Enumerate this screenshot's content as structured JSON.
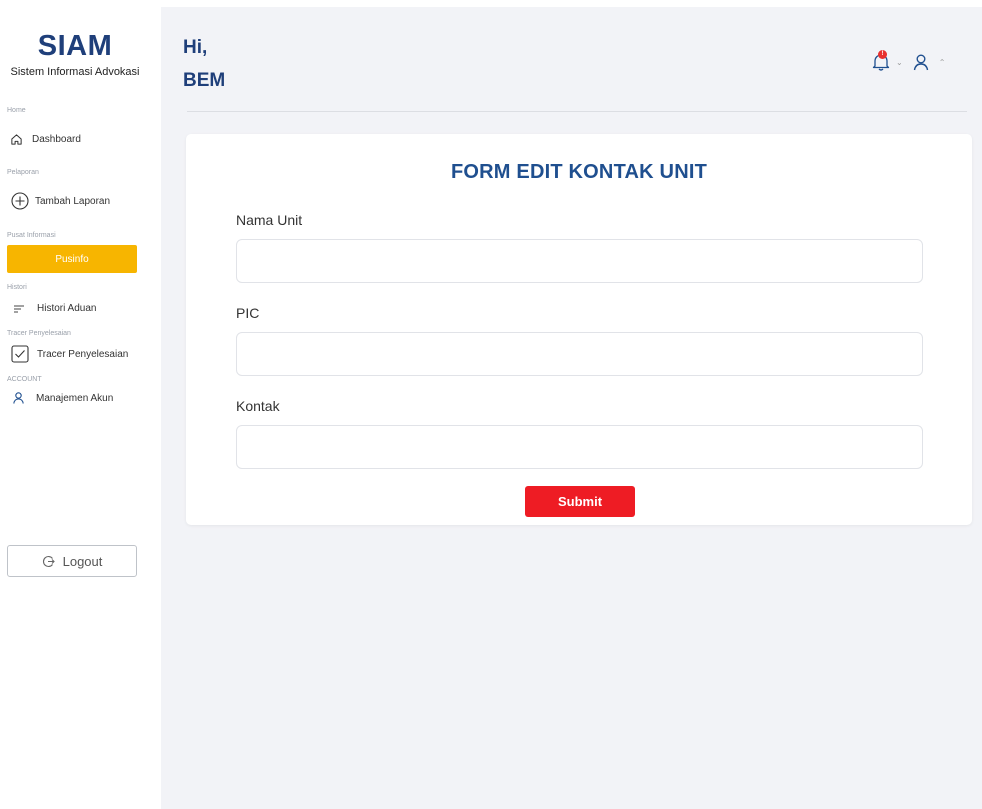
{
  "brand": {
    "title": "SIAM",
    "subtitle": "Sistem Informasi Advokasi"
  },
  "sidebar": {
    "sections": [
      {
        "label": "Home",
        "item": "Dashboard",
        "icon": "home-icon"
      },
      {
        "label": "Pelaporan",
        "item": "Tambah Laporan",
        "icon": "plus-circle-icon"
      },
      {
        "label": "Pusat Informasi",
        "item": "Pusinfo",
        "icon": ""
      },
      {
        "label": "Histori",
        "item": "Histori Aduan",
        "icon": "list-icon"
      },
      {
        "label": "Tracer Penyelesaian",
        "item": "Tracer Penyelesaian",
        "icon": "check-square-icon"
      },
      {
        "label": "ACCOUNT",
        "item": "Manajemen Akun",
        "icon": "user-icon"
      }
    ],
    "active_item": "Pusinfo",
    "active_color": "#f7b500",
    "logout_label": "Logout"
  },
  "header": {
    "greeting_line1": "Hi,",
    "greeting_line2": "BEM",
    "notification_count": "!",
    "icons": [
      "bell-icon",
      "chevron-down-icon",
      "user-icon",
      "chevron-up-icon"
    ]
  },
  "form": {
    "title": "FORM EDIT KONTAK UNIT",
    "fields": [
      {
        "label": "Nama Unit",
        "value": "",
        "placeholder": ""
      },
      {
        "label": "PIC",
        "value": "",
        "placeholder": ""
      },
      {
        "label": "Kontak",
        "value": "",
        "placeholder": ""
      }
    ],
    "submit_label": "Submit",
    "submit_color": "#ee1c24"
  },
  "colors": {
    "brand": "#1f3f7a",
    "background": "#f2f3f7"
  }
}
